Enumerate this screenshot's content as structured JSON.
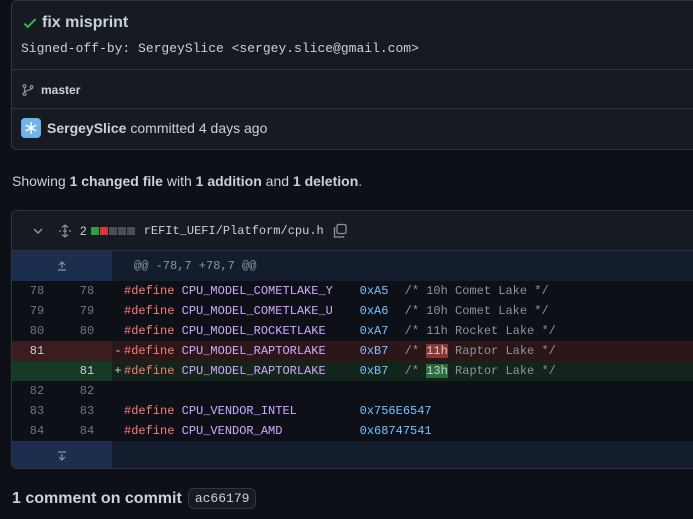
{
  "commit": {
    "title": "fix misprint",
    "body": "Signed-off-by: SergeySlice <sergey.slice@gmail.com>",
    "branch": "master",
    "author": "SergeySlice",
    "committed_text": "committed 4 days ago"
  },
  "summary": {
    "showing": "Showing",
    "changed": "1 changed file",
    "with": "with",
    "additions": "1 addition",
    "and": "and",
    "deletions": "1 deletion",
    "end": "."
  },
  "file": {
    "change_count": "2",
    "path": "rEFIt_UEFI/Platform/cpu.h",
    "diffstat_colors": [
      "#2ea043",
      "#da3633",
      "#484f58",
      "#484f58",
      "#484f58"
    ]
  },
  "diff": {
    "hunk_header": "@@ -78,7 +78,7 @@",
    "rows": [
      {
        "old": "78",
        "new": "78",
        "sign": "",
        "kw": "#define",
        "macro": "CPU_MODEL_COMETLAKE_Y",
        "value": "0xA5",
        "comment": "/* 10h Comet Lake */"
      },
      {
        "old": "79",
        "new": "79",
        "sign": "",
        "kw": "#define",
        "macro": "CPU_MODEL_COMETLAKE_U",
        "value": "0xA6",
        "comment": "/* 10h Comet Lake */"
      },
      {
        "old": "80",
        "new": "80",
        "sign": "",
        "kw": "#define",
        "macro": "CPU_MODEL_ROCKETLAKE",
        "value": "0xA7",
        "comment": "/* 11h Rocket Lake */"
      },
      {
        "old": "81",
        "new": "",
        "sign": "-",
        "kw": "#define",
        "macro": "CPU_MODEL_RAPTORLAKE",
        "value": "0xB7",
        "comment_pre": "/*",
        "comment_hl": "11h",
        "comment_post": "Raptor Lake */"
      },
      {
        "old": "",
        "new": "81",
        "sign": "+",
        "kw": "#define",
        "macro": "CPU_MODEL_RAPTORLAKE",
        "value": "0xB7",
        "comment_pre": "/*",
        "comment_hl": "13h",
        "comment_post": "Raptor Lake */"
      },
      {
        "old": "82",
        "new": "82",
        "sign": "",
        "kw": "",
        "macro": "",
        "value": "",
        "comment": ""
      },
      {
        "old": "83",
        "new": "83",
        "sign": "",
        "kw": "#define",
        "macro": "CPU_VENDOR_INTEL",
        "value": "0x756E6547",
        "comment": ""
      },
      {
        "old": "84",
        "new": "84",
        "sign": "",
        "kw": "#define",
        "macro": "CPU_VENDOR_AMD",
        "value": "0x68747541",
        "comment": ""
      }
    ]
  },
  "comments": {
    "title": "1 comment on commit",
    "sha": "ac66179"
  },
  "icons": {
    "check": "check-icon",
    "branch": "git-branch-icon",
    "collapse": "chevron-down-icon",
    "expand": "unfold-icon",
    "copy": "copy-icon",
    "expand_up": "expand-up-icon",
    "expand_down": "expand-down-icon"
  }
}
